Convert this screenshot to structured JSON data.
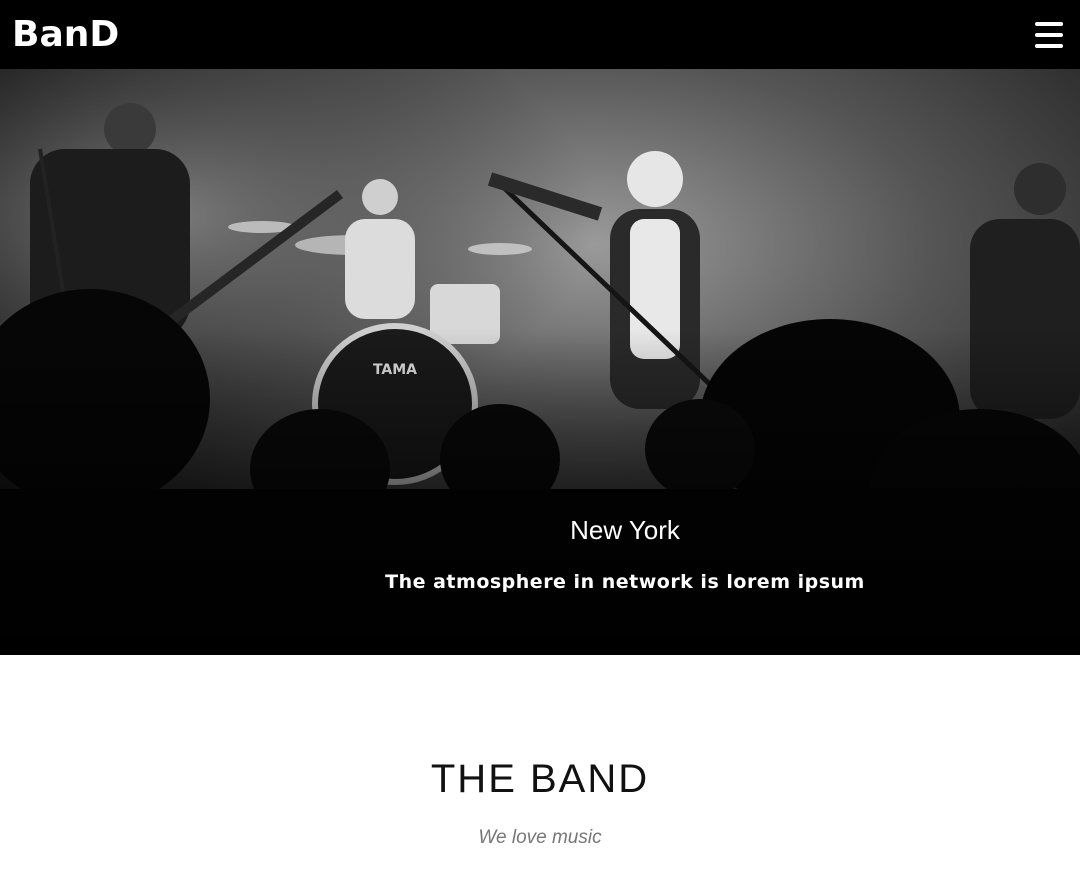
{
  "header": {
    "brand": "BanD",
    "menu_icon": "hamburger-menu-icon"
  },
  "hero": {
    "image": "concert-photo-black-and-white",
    "city": "New York",
    "caption": "The atmosphere in network is lorem ipsum"
  },
  "band_section": {
    "title": "THE BAND",
    "subtitle": "We love music"
  },
  "colors": {
    "header_bg": "#000000",
    "header_text": "#ffffff",
    "page_bg": "#ffffff",
    "title_text": "#111111",
    "subtitle_text": "#777777"
  }
}
